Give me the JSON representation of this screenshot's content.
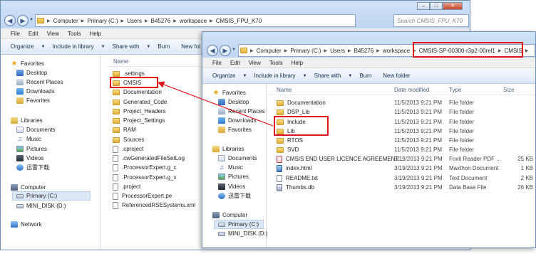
{
  "back_window": {
    "address": [
      "Computer",
      "Primary (C:)",
      "Users",
      "B45276",
      "workspace",
      "CMSIS_FPU_K70"
    ],
    "search_placeholder": "Search CMSIS_FPU_K70",
    "menu": [
      "File",
      "Edit",
      "View",
      "Tools",
      "Help"
    ],
    "commands": [
      "Organize",
      "Include in library",
      "Share with",
      "Burn",
      "New fol"
    ],
    "nav": {
      "favorites": "Favorites",
      "fav_items": [
        "Desktop",
        "Recent Places",
        "Downloads",
        "Favorites"
      ],
      "libraries": "Libraries",
      "lib_items": [
        "Documents",
        "Music",
        "Pictures",
        "Videos",
        "迅雷下载"
      ],
      "computer": "Computer",
      "comp_items": [
        "Primary (C:)",
        "MINI_DISK (D:)"
      ],
      "network": "Network"
    },
    "column_name": "Name",
    "files": [
      ".settings",
      "CMSIS",
      "Documentation",
      "Generated_Code",
      "Project_Headers",
      "Project_Settings",
      "RAM",
      "Sources",
      ".cproject",
      ".cwGeneratedFileSetLog",
      ".ProcessorExpert.g_c",
      ".ProcessorExpert.g_x",
      ".project",
      "ProcessorExpert.pe",
      "ReferencedRSESystems.xml"
    ]
  },
  "front_window": {
    "address": [
      "Computer",
      "Primary (C:)",
      "Users",
      "B45276",
      "workspace",
      "CMSIS-SP-00300-r3p2-00rel1",
      "CMSIS"
    ],
    "menu": [
      "File",
      "Edit",
      "View",
      "Tools",
      "Help"
    ],
    "commands": [
      "Organize",
      "Include in library",
      "Share with",
      "Burn",
      "New folder"
    ],
    "nav": {
      "favorites": "Favorites",
      "fav_items": [
        "Desktop",
        "Recent Places",
        "Downloads",
        "Favorites"
      ],
      "libraries": "Libraries",
      "lib_items": [
        "Documents",
        "Music",
        "Pictures",
        "Videos",
        "迅雷下载"
      ],
      "computer": "Computer",
      "comp_items": [
        "Primary (C:)",
        "MINI_DISK (D:)"
      ]
    },
    "columns": {
      "name": "Name",
      "date": "Date modified",
      "type": "Type",
      "size": "Size"
    },
    "files": [
      {
        "name": "Documentation",
        "date": "11/5/2013 9:21 PM",
        "type": "File folder",
        "size": ""
      },
      {
        "name": "DSP_Lib",
        "date": "11/5/2013 9:21 PM",
        "type": "File folder",
        "size": ""
      },
      {
        "name": "Include",
        "date": "11/5/2013 9:21 PM",
        "type": "File folder",
        "size": ""
      },
      {
        "name": "Lib",
        "date": "11/5/2013 9:21 PM",
        "type": "File folder",
        "size": ""
      },
      {
        "name": "RTOS",
        "date": "11/5/2013 9:21 PM",
        "type": "File folder",
        "size": ""
      },
      {
        "name": "SVD",
        "date": "11/5/2013 9:21 PM",
        "type": "File folder",
        "size": ""
      },
      {
        "name": "CMSIS END USER LICENCE AGREEMENT....",
        "date": "3/19/2013 9:21 PM",
        "type": "Foxit Reader PDF ...",
        "size": "25 KB"
      },
      {
        "name": "index.html",
        "date": "3/19/2013 9:21 PM",
        "type": "Maxthon Document",
        "size": "1 KB"
      },
      {
        "name": "README.txt",
        "date": "3/19/2013 9:21 PM",
        "type": "Text Document",
        "size": "2 KB"
      },
      {
        "name": "Thumbs.db",
        "date": "3/19/2013 9:21 PM",
        "type": "Data Base File",
        "size": "26 KB"
      }
    ]
  },
  "colors": {
    "highlight": "#e0131c",
    "chrome": "#b9d1ee"
  }
}
